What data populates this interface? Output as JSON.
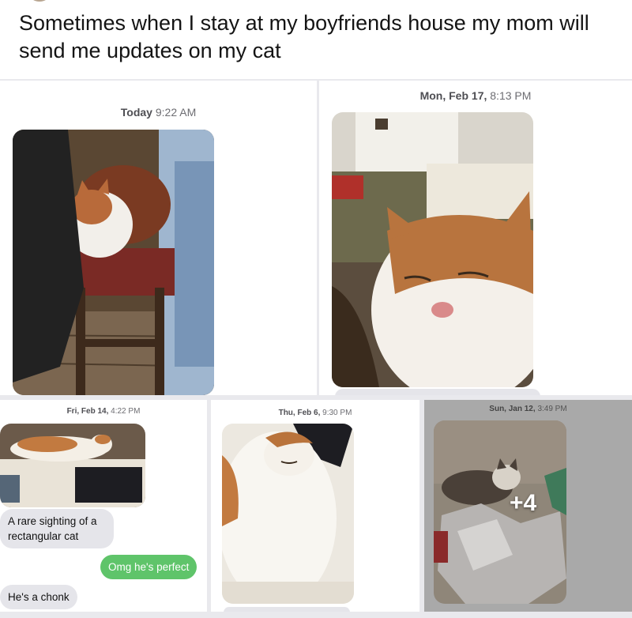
{
  "post": {
    "caption": "Sometimes when I stay at my boyfriends house my mom will send me updates on my cat"
  },
  "screenshots": [
    {
      "timestamp_day": "Today",
      "timestamp_time": "9:22 AM",
      "photo": "cat-on-chair-photo"
    },
    {
      "timestamp_day": "Mon, Feb 17,",
      "timestamp_time": "8:13 PM",
      "photo": "cat-closeup-photo"
    },
    {
      "timestamp_day": "Fri, Feb 14,",
      "timestamp_time": "4:22 PM",
      "photo": "cat-lying-on-bed-photo",
      "messages": [
        {
          "from": "mom",
          "text": "A rare sighting of a rectangular cat"
        },
        {
          "from": "me",
          "text": "Omg he's perfect"
        },
        {
          "from": "mom",
          "text": "He's a chonk"
        }
      ]
    },
    {
      "timestamp_day": "Thu, Feb 6,",
      "timestamp_time": "9:30 PM",
      "photo": "cat-sleeping-photo"
    },
    {
      "timestamp_day": "Sun, Jan 12,",
      "timestamp_time": "3:49 PM",
      "photo": "cat-in-wrapping-paper-photo",
      "more_count": "+4"
    }
  ],
  "colors": {
    "sent_bubble": "#5fc46a",
    "received_bubble": "#e5e5ea",
    "timestamp_text": "#6d6d72",
    "gray_panel": "#a9a9a9"
  }
}
